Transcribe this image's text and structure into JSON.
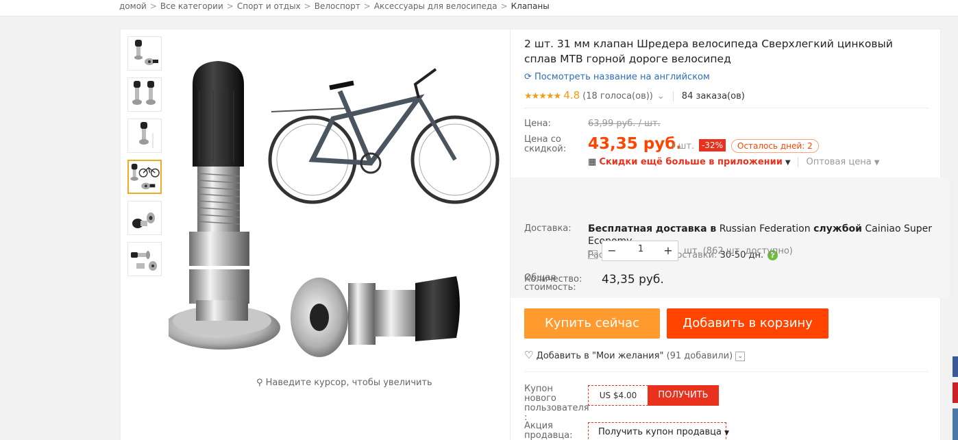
{
  "breadcrumb": [
    "домой",
    "Все категории",
    "Спорт и отдых",
    "Велоспорт",
    "Аксессуары для велосипеда",
    "Клапаны"
  ],
  "breadcrumb_sep": ">",
  "product": {
    "title": "2 шт. 31 мм клапан Шредера велосипеда Сверхлегкий цинковый сплав MTB горной дороге велосипед",
    "translate_link": "Посмотреть название на английском",
    "stars": "★★★★★",
    "rating": "4.8",
    "votes": "(18 голоса(ов))",
    "orders": "84 заказа(ов)",
    "zoom_hint": "Наведите курсор, чтобы увеличить"
  },
  "price": {
    "label": "Цена:",
    "old": "63,99 руб. / шт.",
    "discount_label": "Цена со скидкой:",
    "current": "43,35 руб.",
    "unit": "/ шт.",
    "discount_badge": "-32%",
    "days_left": "Осталось дней: 2",
    "app_discount": "Скидки ещё больше в приложении",
    "wholesale": "Оптовая цена"
  },
  "shipping": {
    "label": "Доставка:",
    "free_prefix": "Бесплатная доставка в",
    "country": "Russian Federation",
    "via": "службой",
    "carrier": "Cainiao Super Economy",
    "eta_label": "Расчётное время доставки:",
    "eta_value": "30-50 дн."
  },
  "quantity": {
    "label": "Количество:",
    "value": "1",
    "stock": "шт. (862 шт. доступно)"
  },
  "total": {
    "label": "Общая стоимость:",
    "value": "43,35 руб."
  },
  "actions": {
    "buy_now": "Купить сейчас",
    "add_to_cart": "Добавить в корзину",
    "wishlist": "Добавить в \"Мои желания\"",
    "wishlist_count": "(91 добавили)"
  },
  "coupons": {
    "new_user_label": "Купон нового пользователя :",
    "new_user_value": "US $4.00",
    "get_label": "ПОЛУЧИТЬ",
    "seller_label": "Акция продавца:",
    "seller_button": "Получить купон продавца"
  },
  "colors": {
    "accent": "#ff4400",
    "buy": "#ff9a2e",
    "link": "#2a6ebb",
    "star": "#f39c12"
  }
}
